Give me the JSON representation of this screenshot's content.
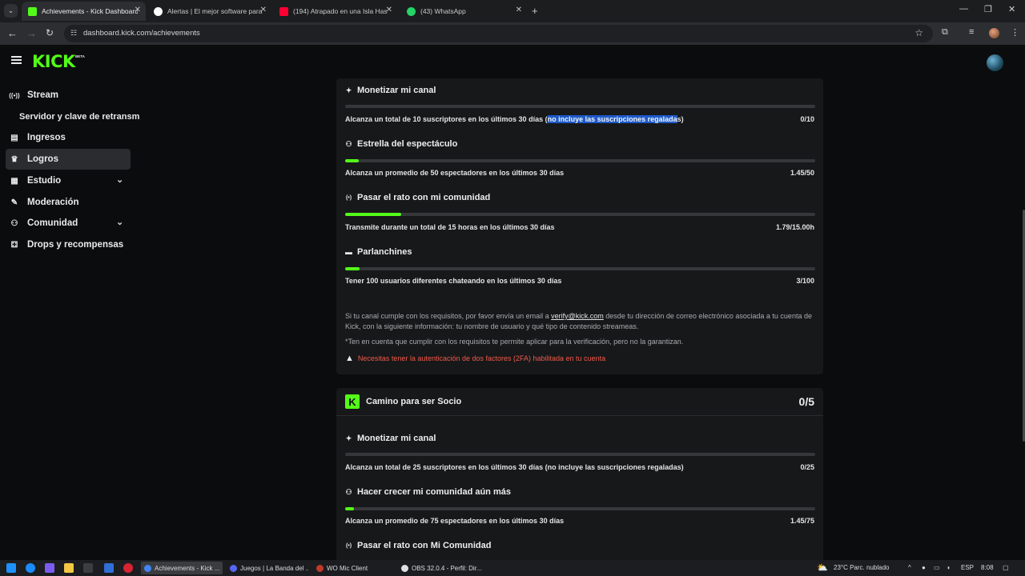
{
  "browser": {
    "tabs": [
      {
        "title": "Achievements - Kick Dashboard",
        "active": true,
        "favicon_color": "#53fc18"
      },
      {
        "title": "Alertas | El mejor software para",
        "active": false,
        "favicon_color": "#ffffff"
      },
      {
        "title": "(194) Atrapado en una Isla Has",
        "active": false,
        "favicon_color": "#ff0033"
      },
      {
        "title": "(43) WhatsApp",
        "active": false,
        "favicon_color": "#25d366"
      }
    ],
    "url": "dashboard.kick.com/achievements"
  },
  "app": {
    "logo": "KICK",
    "logo_badge": "BETA",
    "accent": "#53fc18"
  },
  "sidebar": {
    "items": [
      {
        "label": "Stream",
        "icon": "broadcast-icon",
        "glyph": "((•))"
      },
      {
        "label": "Ingresos",
        "icon": "chart-icon",
        "glyph": "▤"
      },
      {
        "label": "Logros",
        "icon": "trophy-icon",
        "glyph": "🏆"
      },
      {
        "label": "Estudio",
        "icon": "studio-icon",
        "glyph": "▦"
      },
      {
        "label": "Moderación",
        "icon": "wrench-icon",
        "glyph": "🔧"
      },
      {
        "label": "Comunidad",
        "icon": "community-icon",
        "glyph": "👥"
      },
      {
        "label": "Drops y recompensas",
        "icon": "drops-icon",
        "glyph": "🎁"
      }
    ],
    "sub_item": "Servidor y clave de retransm"
  },
  "affiliate": {
    "achievements": [
      {
        "title": "Monetizar mi canal",
        "icon": "sparkle-icon",
        "progress": 0.0,
        "desc_before": "Alcanza un total de 10 suscriptores en los últimos 30 días (",
        "desc_highlight": "no incluye las suscripciones regalada",
        "desc_after": "s)",
        "value": "0/10"
      },
      {
        "title": "Estrella del espectáculo",
        "icon": "viewers-icon",
        "progress": 0.029,
        "desc": "Alcanza un promedio de 50 espectadores en los últimos 30 días",
        "value": "1.45/50"
      },
      {
        "title": "Pasar el rato con mi comunidad",
        "icon": "broadcast-icon",
        "progress": 0.119,
        "desc": "Transmite durante un total de 15 horas en los últimos 30 días",
        "value": "1.79/15.00h"
      },
      {
        "title": "Parlanchines",
        "icon": "chat-icon",
        "progress": 0.03,
        "desc": "Tener 100 usuarios diferentes chateando en los últimos 30 días",
        "value": "3/100"
      }
    ],
    "info_before": "Si tu canal cumple con los requisitos, por favor envía un email a ",
    "info_email": "verify@kick.com",
    "info_after": " desde tu dirección de correo electrónico asociada a tu cuenta de Kick, con la siguiente información: tu nombre de usuario y qué tipo de contenido streameas.",
    "note": "*Ten en cuenta que cumplir con los requisitos te permite aplicar para la verificación, pero no la garantizan.",
    "warning": "Necesitas tener la autenticación de dos factores (2FA) habilitada en tu cuenta"
  },
  "partner": {
    "title": "Camino para ser Socio",
    "count": "0/5",
    "achievements": [
      {
        "title": "Monetizar mi canal",
        "icon": "sparkle-icon",
        "progress": 0.0,
        "desc": "Alcanza un total de 25 suscriptores en los últimos 30 días (no incluye las suscripciones regaladas)",
        "value": "0/25"
      },
      {
        "title": "Hacer crecer mi comunidad aún más",
        "icon": "viewers-icon",
        "progress": 0.019,
        "desc": "Alcanza un promedio de 75 espectadores en los últimos 30 días",
        "value": "1.45/75"
      },
      {
        "title": "Pasar el rato con Mi Comunidad",
        "icon": "broadcast-icon"
      }
    ]
  },
  "taskbar": {
    "apps": [
      {
        "label": "Achievements - Kick ...",
        "active": true,
        "color": "#4285f4"
      },
      {
        "label": "Juegos | La Banda del ...",
        "active": false,
        "color": "#5865f2"
      },
      {
        "label": "WO Mic Client",
        "active": false,
        "color": "#c0392b"
      },
      {
        "label": "OBS 32.0.4 - Perfil: Dir...",
        "active": false,
        "color": "#e0e0e0"
      }
    ],
    "weather": "23°C  Parc. nublado",
    "lang": "ESP",
    "time": "8:08"
  }
}
